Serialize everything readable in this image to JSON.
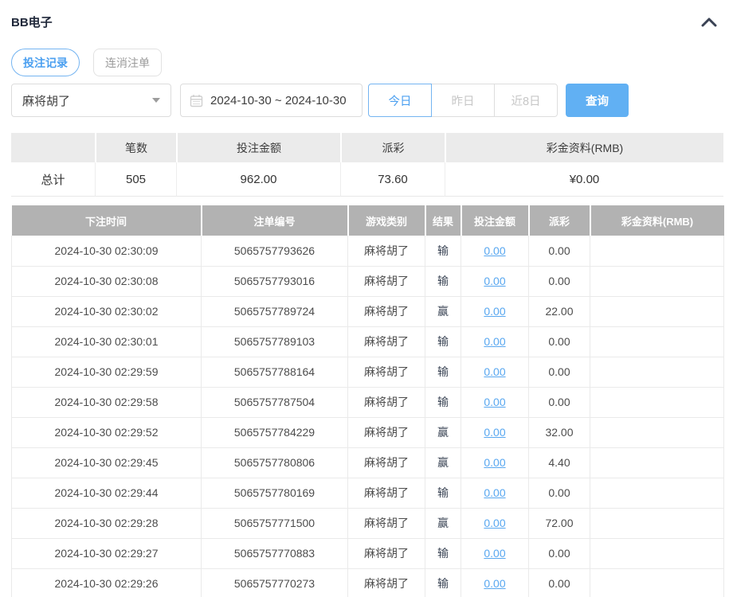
{
  "colors": {
    "accent_border": "#74b4f1",
    "accent_text": "#4a9ff0",
    "accent_fill": "#61b0f3",
    "link_blue": "#58a7f0",
    "table_header_gray": "#b2b2b2"
  },
  "header": {
    "title": "BB电子",
    "collapse_icon": "chevron-up"
  },
  "tabs": [
    {
      "label": "投注记录",
      "active": true
    },
    {
      "label": "连消注单",
      "active": false
    }
  ],
  "filters": {
    "game_select": {
      "value": "麻将胡了",
      "caret_icon": "caret-down"
    },
    "date_range": {
      "value": "2024-10-30 ~ 2024-10-30",
      "icon": "calendar"
    },
    "quick_buttons": [
      {
        "label": "今日",
        "active": true
      },
      {
        "label": "昨日",
        "active": false
      },
      {
        "label": "近8日",
        "active": false
      }
    ],
    "query_label": "查询"
  },
  "summary": {
    "headers": [
      "",
      "笔数",
      "投注金额",
      "派彩",
      "彩金资料(RMB)"
    ],
    "total": {
      "label": "总计",
      "count": "505",
      "bet_amount": "962.00",
      "payout": "73.60",
      "bonus": "¥0.00"
    }
  },
  "table": {
    "headers": [
      "下注时间",
      "注单编号",
      "游戏类别",
      "结果",
      "投注金额",
      "派彩",
      "彩金资料(RMB)"
    ],
    "rows": [
      {
        "time": "2024-10-30 02:30:09",
        "id": "5065757793626",
        "game": "麻将胡了",
        "result": "输",
        "bet": "0.00",
        "payout": "0.00",
        "bonus": ""
      },
      {
        "time": "2024-10-30 02:30:08",
        "id": "5065757793016",
        "game": "麻将胡了",
        "result": "输",
        "bet": "0.00",
        "payout": "0.00",
        "bonus": ""
      },
      {
        "time": "2024-10-30 02:30:02",
        "id": "5065757789724",
        "game": "麻将胡了",
        "result": "赢",
        "bet": "0.00",
        "payout": "22.00",
        "bonus": ""
      },
      {
        "time": "2024-10-30 02:30:01",
        "id": "5065757789103",
        "game": "麻将胡了",
        "result": "输",
        "bet": "0.00",
        "payout": "0.00",
        "bonus": ""
      },
      {
        "time": "2024-10-30 02:29:59",
        "id": "5065757788164",
        "game": "麻将胡了",
        "result": "输",
        "bet": "0.00",
        "payout": "0.00",
        "bonus": ""
      },
      {
        "time": "2024-10-30 02:29:58",
        "id": "5065757787504",
        "game": "麻将胡了",
        "result": "输",
        "bet": "0.00",
        "payout": "0.00",
        "bonus": ""
      },
      {
        "time": "2024-10-30 02:29:52",
        "id": "5065757784229",
        "game": "麻将胡了",
        "result": "赢",
        "bet": "0.00",
        "payout": "32.00",
        "bonus": ""
      },
      {
        "time": "2024-10-30 02:29:45",
        "id": "5065757780806",
        "game": "麻将胡了",
        "result": "赢",
        "bet": "0.00",
        "payout": "4.40",
        "bonus": ""
      },
      {
        "time": "2024-10-30 02:29:44",
        "id": "5065757780169",
        "game": "麻将胡了",
        "result": "输",
        "bet": "0.00",
        "payout": "0.00",
        "bonus": ""
      },
      {
        "time": "2024-10-30 02:29:28",
        "id": "5065757771500",
        "game": "麻将胡了",
        "result": "赢",
        "bet": "0.00",
        "payout": "72.00",
        "bonus": ""
      },
      {
        "time": "2024-10-30 02:29:27",
        "id": "5065757770883",
        "game": "麻将胡了",
        "result": "输",
        "bet": "0.00",
        "payout": "0.00",
        "bonus": ""
      },
      {
        "time": "2024-10-30 02:29:26",
        "id": "5065757770273",
        "game": "麻将胡了",
        "result": "输",
        "bet": "0.00",
        "payout": "0.00",
        "bonus": ""
      }
    ]
  }
}
